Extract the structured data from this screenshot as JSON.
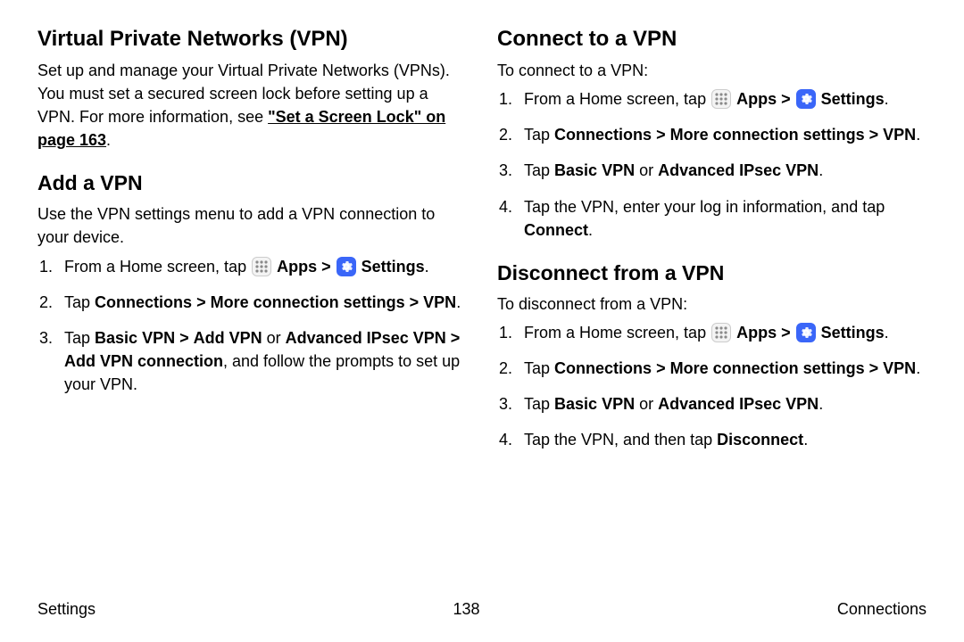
{
  "icons": {
    "chev": ">"
  },
  "left": {
    "h1": "Virtual Private Networks (VPN)",
    "intro1": "Set up and manage your Virtual Private Networks (VPNs). You must set a secured screen lock before setting up a VPN. For more information, see ",
    "intro_link": "\"Set a Screen Lock\" on page 163",
    "intro_tail": ".",
    "h2": "Add a VPN",
    "p2": "Use the VPN settings menu to add a VPN connection to your device.",
    "li1a": "From a Home screen, tap ",
    "li1_apps": "Apps",
    "li1_settings": "Settings",
    "li1_tail": ".",
    "li2a": "Tap ",
    "li2b": "Connections",
    "li2c": "More connection settings",
    "li2d": "VPN",
    "li2_tail": ".",
    "li3a": "Tap ",
    "li3b": "Basic VPN",
    "li3c": "Add VPN",
    "li3d": " or ",
    "li3e": "Advanced IPsec VPN",
    "li3f": "Add VPN connection",
    "li3g": ", and follow the prompts to set up your VPN."
  },
  "right": {
    "h1": "Connect to a VPN",
    "p1": "To connect to a VPN:",
    "c_li1a": "From a Home screen, tap ",
    "c_li1_apps": "Apps",
    "c_li1_settings": "Settings",
    "c_li1_tail": ".",
    "c_li2a": "Tap ",
    "c_li2b": "Connections",
    "c_li2c": "More connection settings",
    "c_li2d": "VPN",
    "c_li2_tail": ".",
    "c_li3a": "Tap ",
    "c_li3b": "Basic VPN",
    "c_li3c": " or ",
    "c_li3d": "Advanced IPsec VPN",
    "c_li3_tail": ".",
    "c_li4a": "Tap the VPN, enter your log in information, and tap ",
    "c_li4b": "Connect",
    "c_li4_tail": ".",
    "h2": "Disconnect from a VPN",
    "p2": "To disconnect from a VPN:",
    "d_li1a": "From a Home screen, tap ",
    "d_li1_apps": "Apps",
    "d_li1_settings": "Settings",
    "d_li1_tail": ".",
    "d_li2a": "Tap ",
    "d_li2b": "Connections",
    "d_li2c": "More connection settings",
    "d_li2d": "VPN",
    "d_li2_tail": ".",
    "d_li3a": "Tap ",
    "d_li3b": "Basic VPN",
    "d_li3c": " or ",
    "d_li3d": "Advanced IPsec VPN",
    "d_li3_tail": ".",
    "d_li4a": "Tap the VPN, and then tap ",
    "d_li4b": "Disconnect",
    "d_li4_tail": "."
  },
  "footer": {
    "left": "Settings",
    "center": "138",
    "right": "Connections"
  }
}
